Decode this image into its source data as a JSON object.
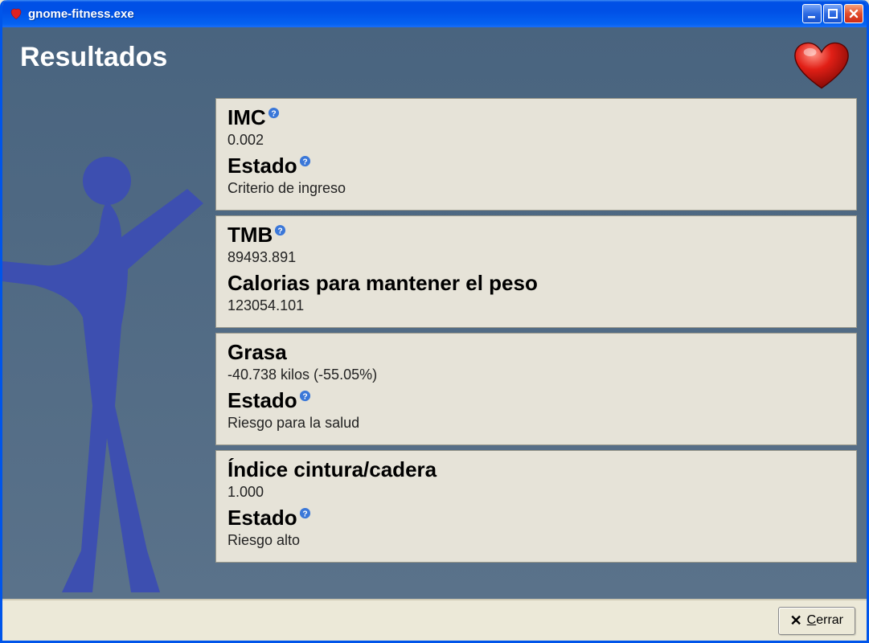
{
  "window": {
    "title": "gnome-fitness.exe"
  },
  "page": {
    "title": "Resultados"
  },
  "panels": {
    "imc": {
      "label": "IMC",
      "value": "0.002",
      "state_label": "Estado",
      "state_value": "Criterio de ingreso"
    },
    "tmb": {
      "label": "TMB",
      "value": "89493.891",
      "calories_label": "Calorias para mantener el peso",
      "calories_value": "123054.101"
    },
    "grasa": {
      "label": "Grasa",
      "value": "-40.738 kilos (-55.05%)",
      "state_label": "Estado",
      "state_value": "Riesgo para la salud"
    },
    "icc": {
      "label": "Índice cintura/cadera",
      "value": "1.000",
      "state_label": "Estado",
      "state_value": "Riesgo alto"
    }
  },
  "footer": {
    "close_label": "Cerrar"
  }
}
